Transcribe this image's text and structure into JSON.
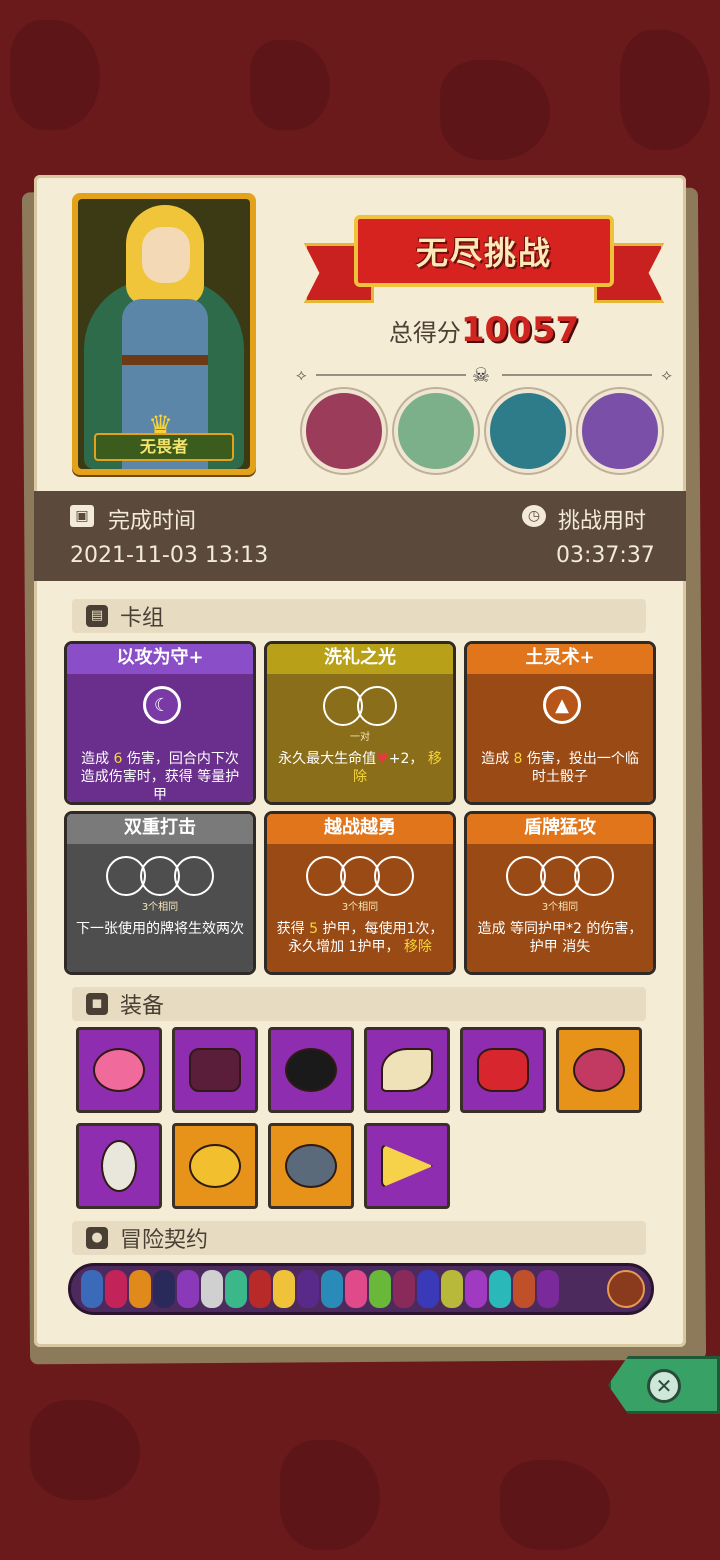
{
  "hero": {
    "name": "无畏者"
  },
  "challenge": {
    "title": "无尽挑战",
    "score_label": "总得分",
    "score_value": "10057"
  },
  "bosses": [
    {
      "icon": "stone-golem-boss-icon",
      "color": "#9b3c5a"
    },
    {
      "icon": "green-lizard-boss-icon",
      "color": "#7bb08a"
    },
    {
      "icon": "armored-knight-boss-icon",
      "color": "#2e7c8a"
    },
    {
      "icon": "purple-dragon-boss-icon",
      "color": "#7a4fa8"
    }
  ],
  "times": {
    "completion_label": "完成时间",
    "completion_value": "2021-11-03 13:13",
    "duration_label": "挑战用时",
    "duration_value": "03:37:37"
  },
  "deck": {
    "header": "卡组",
    "cards": [
      {
        "title": "以攻为守+",
        "style": "purple",
        "icon": "moon-icon",
        "desc_a": "造成",
        "desc_num": "6",
        "desc_b": "伤害，回合内下次造成伤害时，获得 等量",
        "desc_c": "护甲"
      },
      {
        "title": "洗礼之光",
        "style": "olive",
        "sub": "一对",
        "desc_a": "永久最大生命值",
        "desc_num": "+2，",
        "desc_b": "移除"
      },
      {
        "title": "土灵术+",
        "style": "orange",
        "icon": "mountain-icon",
        "desc_a": "造成",
        "desc_num": "8",
        "desc_b": "伤害，投出一个临时土骰子"
      },
      {
        "title": "双重打击",
        "style": "gray",
        "sub": "3个相同",
        "desc_a": "下一张使用的牌将生效两次"
      },
      {
        "title": "越战越勇",
        "style": "orange",
        "sub": "3个相同",
        "desc_a": "获得",
        "desc_num": "5",
        "desc_b": "护甲，每使用1次，永久增加",
        "desc_num2": "1",
        "desc_c": "护甲，",
        "desc_d": "移除"
      },
      {
        "title": "盾牌猛攻",
        "style": "orange",
        "sub": "3个相同",
        "desc_a": "造成 等同",
        "desc_b": "护甲*2 的伤害，",
        "desc_c": "护甲 消失"
      }
    ]
  },
  "equipment": {
    "header": "装备",
    "items": [
      {
        "icon": "pink-mushroom-icon",
        "bg": "purple"
      },
      {
        "icon": "vest-armor-icon",
        "bg": "purple"
      },
      {
        "icon": "shadow-rune-icon",
        "bg": "purple"
      },
      {
        "icon": "fang-claws-icon",
        "bg": "purple"
      },
      {
        "icon": "red-gem-icon",
        "bg": "purple"
      },
      {
        "icon": "tribal-mask-icon",
        "bg": "orange"
      },
      {
        "icon": "mirror-icon",
        "bg": "purple"
      },
      {
        "icon": "gold-coin-icon",
        "bg": "orange"
      },
      {
        "icon": "stone-amulet-icon",
        "bg": "orange"
      },
      {
        "icon": "cheese-wedge-icon",
        "bg": "purple"
      }
    ]
  },
  "contract": {
    "header": "冒险契约"
  }
}
